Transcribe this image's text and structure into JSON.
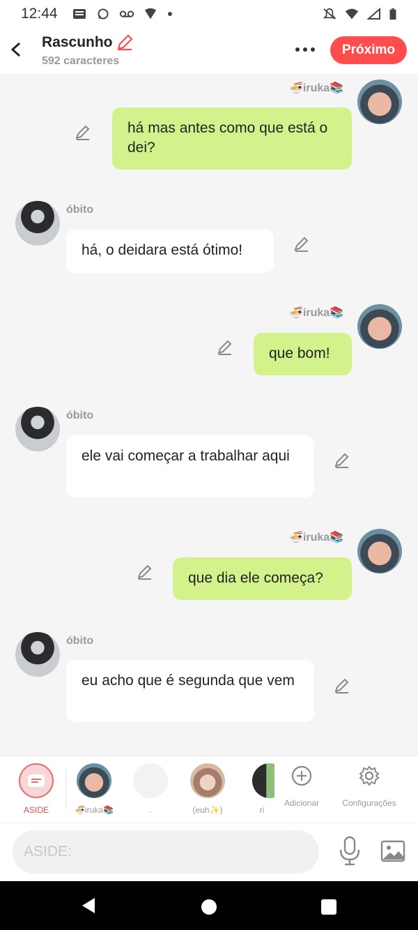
{
  "status_bar": {
    "time": "12:44"
  },
  "header": {
    "title": "Rascunho",
    "subtitle": "592 caracteres",
    "next_label": "Próximo"
  },
  "messages": [
    {
      "side": "right",
      "sender": "🍜iruka📚",
      "text": "há mas antes como que está o dei?"
    },
    {
      "side": "left",
      "sender": "óbito",
      "text": "há, o deidara está ótimo!"
    },
    {
      "side": "right",
      "sender": "🍜iruka📚",
      "text": "que bom!"
    },
    {
      "side": "left",
      "sender": "óbito",
      "text": "ele vai começar a trabalhar aqui"
    },
    {
      "side": "right",
      "sender": "🍜iruka📚",
      "text": "que dia ele começa?"
    },
    {
      "side": "left",
      "sender": "óbito",
      "text": "eu acho que é segunda que vem"
    }
  ],
  "character_bar": {
    "items": [
      {
        "label": "ASIDE"
      },
      {
        "label": "🍜iruka📚"
      },
      {
        "label": "."
      },
      {
        "label": "(euh✨)"
      },
      {
        "label": "ri"
      },
      {
        "label": "Adicionar"
      },
      {
        "label": "Configurações"
      }
    ]
  },
  "input": {
    "placeholder": "ASIDE:"
  },
  "colors": {
    "accent": "#ff4d4d",
    "my_bubble": "#d4f28c",
    "other_bubble": "#ffffff"
  }
}
